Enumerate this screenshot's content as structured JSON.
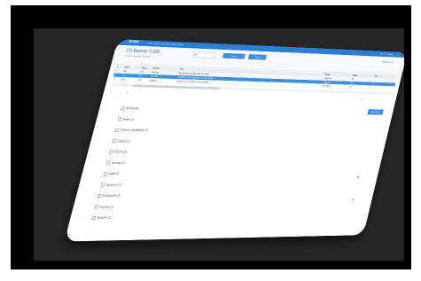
{
  "window": {
    "brand": "ExSite",
    "links": "Home  About  Learn  Tools  Help  Contact",
    "top_right": "Sign in  |  Register"
  },
  "header": {
    "title": "Ch Basmer 3.009",
    "subtitle": "Search / Browse / Results",
    "select_value": "All",
    "button1": "Search",
    "button2": "Export",
    "right_text": "Hollybrand Ltd"
  },
  "tabs": [
    {
      "label": "1",
      "active": true
    },
    {
      "label": "2",
      "active": false
    },
    {
      "label": "All Results",
      "active": false
    }
  ],
  "table": {
    "headers": [
      "#",
      "Code",
      "Lang",
      "Source",
      "Text",
      "Target",
      "Status",
      "Edit"
    ],
    "rows": [
      [
        "1",
        "A01",
        "EN",
        "Baseline",
        "Source string sample entry for review",
        "Target text",
        "OK",
        "—"
      ],
      [
        "2",
        "A02",
        "EN",
        "Baseline",
        "Translated content selected line item shown",
        "Target text",
        "OK",
        "—"
      ],
      [
        "3",
        "A03",
        "EN",
        "Baseline",
        "Another source string row entry sample",
        "Target text",
        "OK",
        "—"
      ]
    ]
  },
  "toolbar": {
    "right_text": "1 - 3 of 3"
  },
  "filter_button": "Show More",
  "languages": [
    "All Results",
    "Arabic (1)",
    "Chinese (Simplified) (1)",
    "English (1)",
    "French (1)",
    "German (1)",
    "Hindi (1)",
    "Japanese (1)",
    "Portuguese (1)",
    "Russian (1)",
    "Spanish (1)"
  ],
  "side_icons": [
    "x-icon",
    "menu-icon"
  ]
}
